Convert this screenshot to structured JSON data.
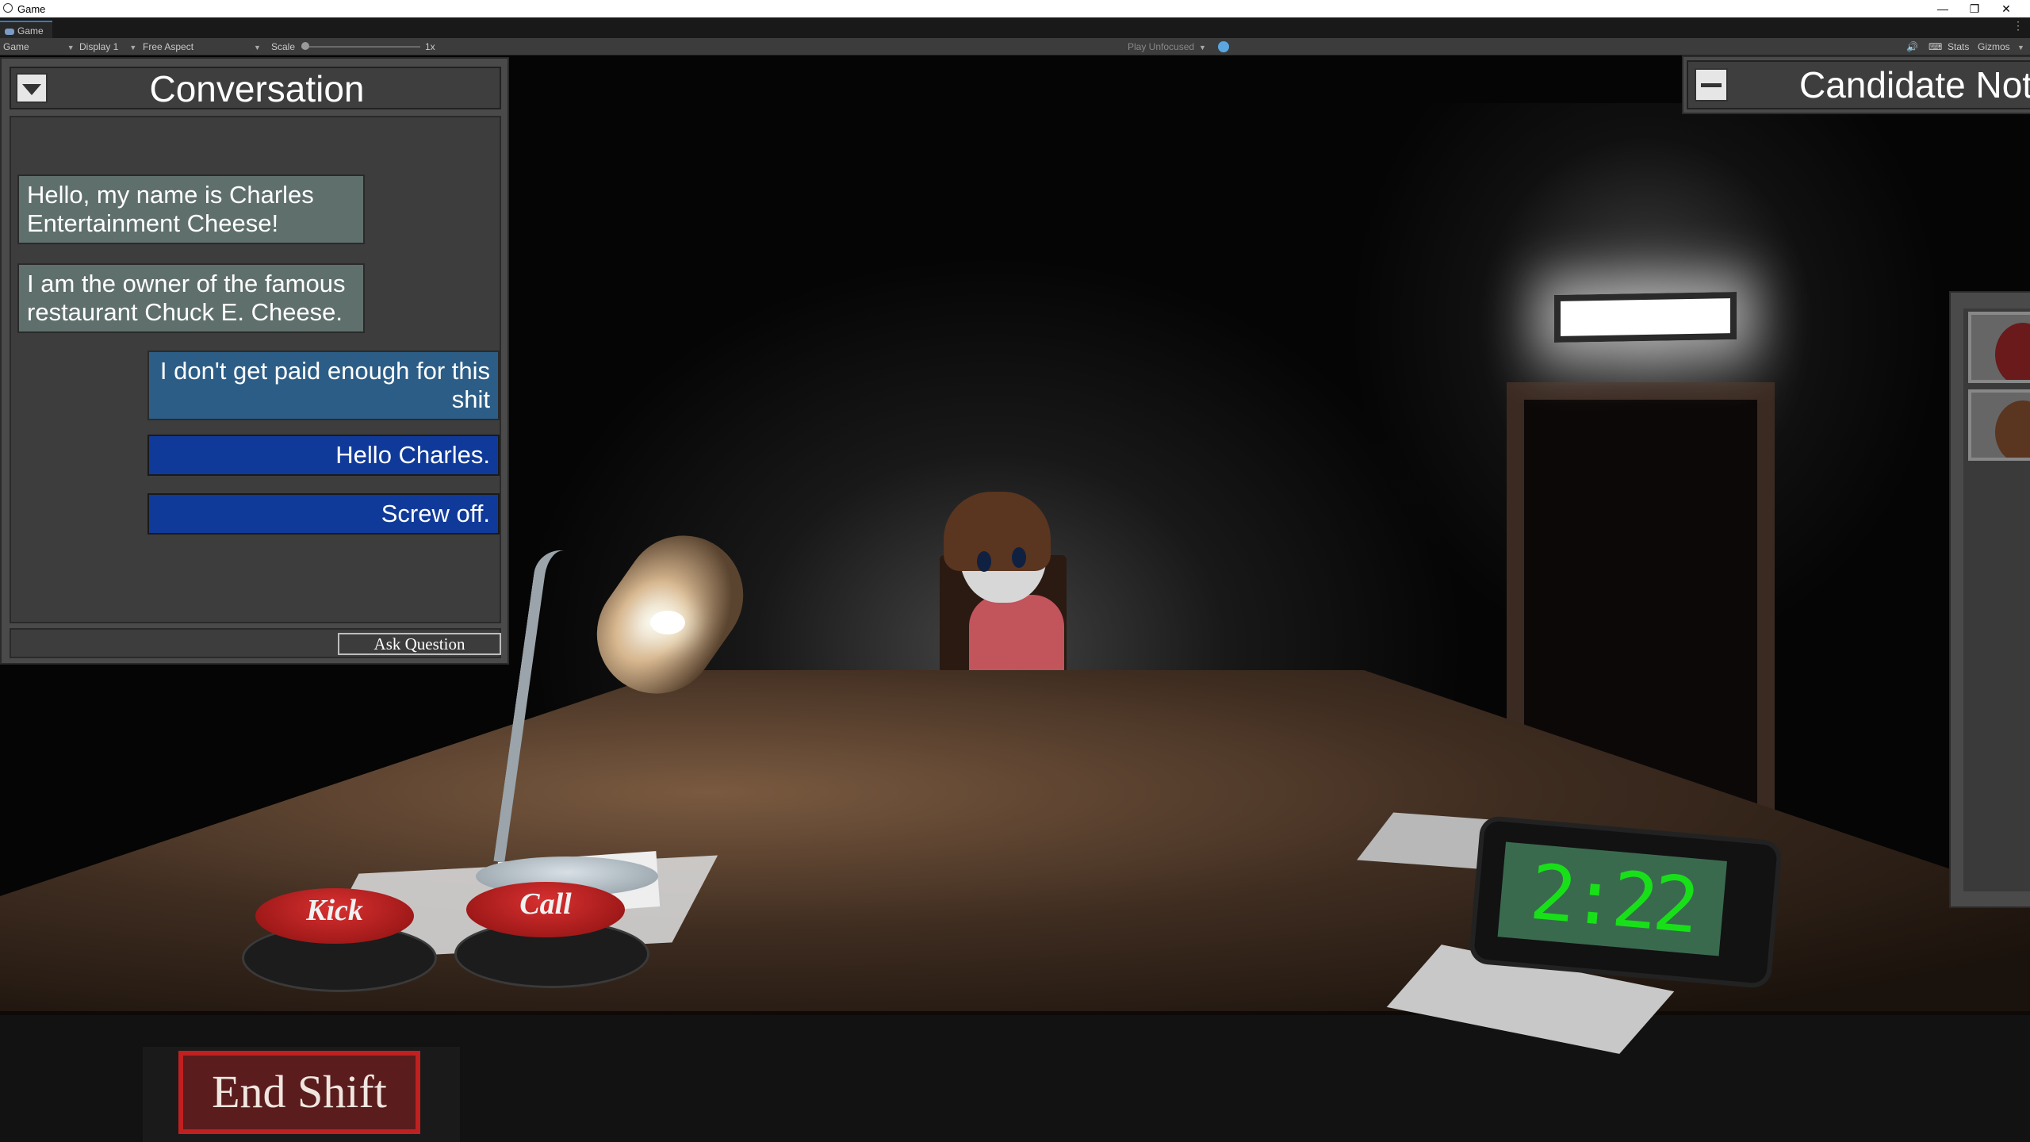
{
  "window": {
    "title": "Game",
    "minimize": "—",
    "restore": "❐",
    "close": "✕"
  },
  "tabbar": {
    "tab_label": "Game",
    "menu": "⋮"
  },
  "toolbar": {
    "view_mode": "Game",
    "display": "Display 1",
    "aspect": "Free Aspect",
    "scale_label": "Scale",
    "scale_value": "1x",
    "play_mode": "Play Unfocused",
    "stats": "Stats",
    "gizmos": "Gizmos"
  },
  "conversation": {
    "title": "Conversation",
    "messages": [
      {
        "speaker": "candidate",
        "text": "Hello, my name is Charles Entertainment Cheese!"
      },
      {
        "speaker": "candidate",
        "text": "I am the owner of the famous restaurant Chuck E. Cheese."
      },
      {
        "speaker": "player",
        "text": "I don't get paid enough for this shit"
      }
    ],
    "choices": [
      "Hello Charles.",
      "Screw off."
    ],
    "ask_button": "Ask Question"
  },
  "candidate_notes": {
    "title": "Candidate Not"
  },
  "desk": {
    "kick_button": "Kick",
    "call_button": "Call",
    "clock_time": "2:22",
    "end_shift": "End Shift"
  },
  "colors": {
    "npc_bubble": "#5f6f6c",
    "player_bubble": "#2c5d86",
    "choice_button": "#103a9a",
    "clock_digits": "#18e018",
    "desk_button": "#c02020"
  }
}
